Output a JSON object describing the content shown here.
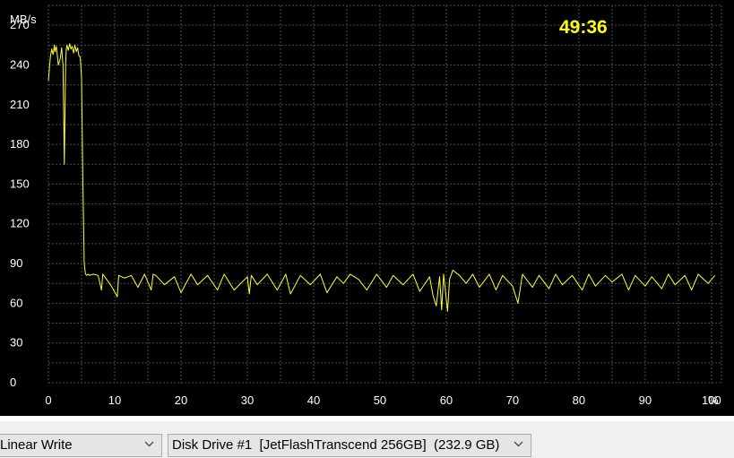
{
  "timer": "49:36",
  "colors": {
    "background": "#000000",
    "grid": "#4a4a4a",
    "axis_text": "#ffffff",
    "series": "#ffff33",
    "timer": "#ffff00"
  },
  "controls": {
    "mode_value": "Linear Write",
    "drive_value": "Disk Drive #1  [JetFlashTranscend 256GB]  (232.9 GB)",
    "chevron_icon": "chevron-down-icon"
  },
  "chart_data": {
    "type": "line",
    "ylabel": "MB/s",
    "xunit": "%",
    "xlim": [
      0,
      101.5
    ],
    "ylim": [
      0,
      285
    ],
    "x_ticks": [
      0,
      10,
      20,
      30,
      40,
      50,
      60,
      70,
      80,
      90,
      100
    ],
    "y_ticks": [
      0,
      30,
      60,
      90,
      120,
      150,
      180,
      210,
      240,
      270
    ],
    "grid": true,
    "series": [
      {
        "x": [
          0.0,
          0.3,
          0.5,
          0.7,
          0.9,
          1.0,
          1.2,
          1.5,
          1.8,
          2.0,
          2.2,
          2.4,
          2.6,
          2.7,
          2.8,
          3.0,
          3.2,
          3.4,
          3.6,
          3.8,
          4.0,
          4.2,
          4.4,
          4.6,
          4.8,
          5.0,
          5.2,
          5.4,
          5.6,
          5.8,
          6.0,
          6.2,
          6.8,
          7.5,
          8.0,
          8.2,
          8.5,
          9.5,
          10.4,
          10.6,
          11.5,
          12.5,
          13.5,
          14.5,
          15.5,
          15.8,
          16.2,
          17.5,
          19.0,
          20.0,
          21.5,
          22.5,
          24.0,
          25.5,
          26.5,
          28.0,
          30.0,
          30.3,
          30.6,
          31.5,
          33.0,
          34.5,
          35.8,
          36.5,
          38.0,
          39.5,
          41.0,
          42.0,
          43.5,
          44.5,
          45.5,
          46.8,
          48.0,
          49.5,
          51.0,
          52.0,
          53.5,
          55.0,
          56.0,
          57.5,
          58.0,
          58.5,
          59.0,
          59.3,
          59.6,
          60.2,
          60.5,
          61.0,
          62.0,
          63.0,
          64.0,
          65.0,
          66.5,
          67.5,
          68.5,
          70.0,
          70.8,
          71.5,
          73.0,
          74.0,
          75.5,
          76.5,
          77.5,
          79.0,
          80.5,
          81.5,
          82.5,
          84.0,
          85.0,
          86.5,
          87.5,
          88.5,
          90.0,
          91.0,
          92.5,
          93.5,
          94.5,
          96.0,
          97.0,
          98.0,
          99.5,
          100.5
        ],
        "y": [
          228,
          246,
          252,
          248,
          255,
          250,
          254,
          240,
          245,
          253,
          240,
          165,
          240,
          252,
          255,
          251,
          256,
          252,
          254,
          249,
          255,
          250,
          253,
          247,
          246,
          230,
          150,
          90,
          82,
          81,
          82,
          81,
          82,
          81,
          70,
          82,
          80,
          73,
          65,
          81,
          79,
          81,
          72,
          82,
          70,
          82,
          81,
          74,
          80,
          68,
          82,
          74,
          81,
          70,
          82,
          70,
          80,
          67,
          81,
          74,
          82,
          70,
          82,
          67,
          81,
          74,
          82,
          68,
          80,
          75,
          82,
          78,
          70,
          82,
          72,
          81,
          74,
          82,
          69,
          80,
          66,
          58,
          80,
          55,
          82,
          54,
          78,
          85,
          81,
          75,
          82,
          72,
          82,
          70,
          81,
          73,
          60,
          82,
          72,
          81,
          71,
          82,
          74,
          81,
          70,
          82,
          73,
          81,
          76,
          82,
          70,
          81,
          73,
          80,
          71,
          82,
          74,
          81,
          70,
          82,
          75,
          81
        ]
      }
    ]
  }
}
